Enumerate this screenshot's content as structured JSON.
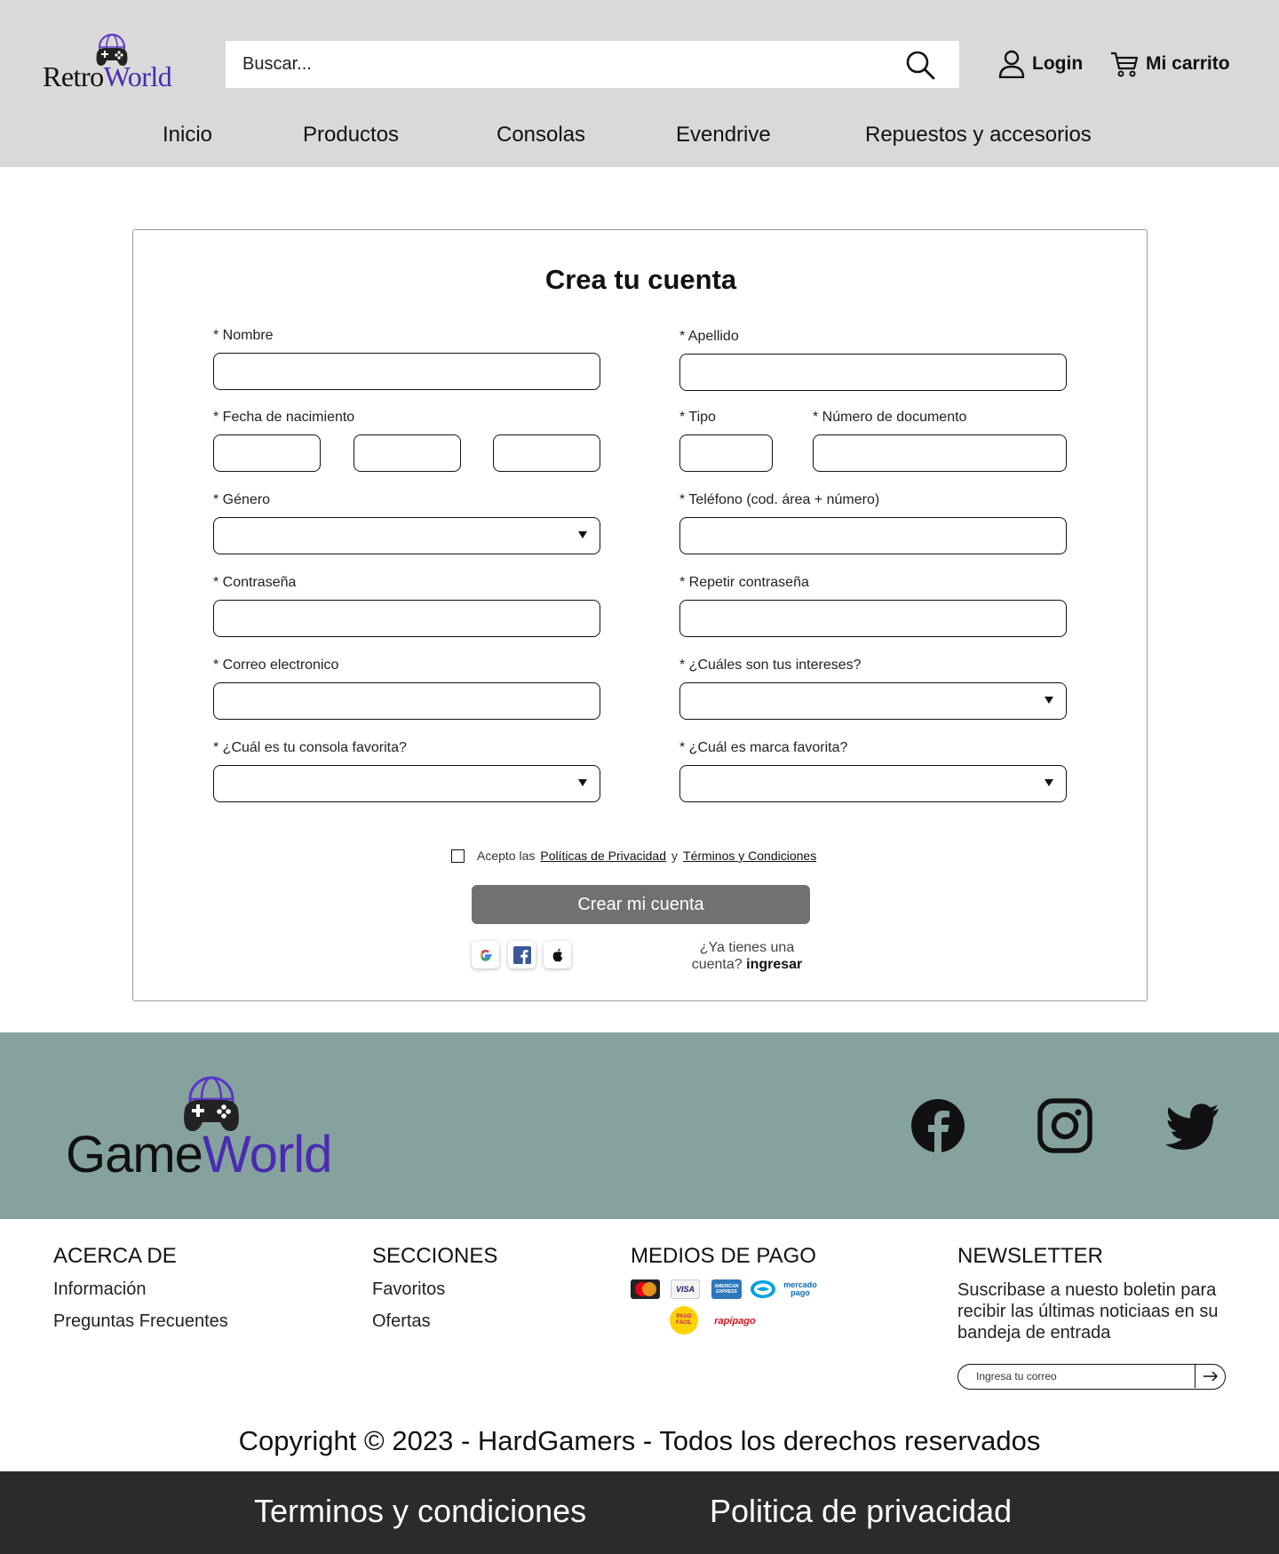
{
  "header": {
    "logo": {
      "part1": "Retro",
      "part2": "World"
    },
    "search_placeholder": "Buscar...",
    "login_label": "Login",
    "cart_label": "Mi carrito",
    "nav": [
      "Inicio",
      "Productos",
      "Consolas",
      "Evendrive",
      "Repuestos y accesorios"
    ]
  },
  "form": {
    "title": "Crea tu cuenta",
    "labels": {
      "nombre": "* Nombre",
      "apellido": "* Apellido",
      "fecha": "* Fecha de nacimiento",
      "tipo": "* Tipo",
      "documento": "* Número de documento",
      "genero": "* Género",
      "telefono": "* Teléfono (cod. área + número)",
      "contrasena": "* Contraseña",
      "repetir": "* Repetir contraseña",
      "correo": "* Correo electronico",
      "intereses": "* ¿Cuáles son tus intereses?",
      "consola": "* ¿Cuál es tu consola favorita?",
      "marca": "* ¿Cuál es marca favorita?"
    },
    "terms": {
      "prefix": "Acepto las",
      "privacy": "Políticas de Privacidad",
      "and": "y",
      "conditions": "Términos y Condiciones"
    },
    "submit_label": "Crear mi cuenta",
    "social_icons": [
      "google-icon",
      "facebook-icon",
      "apple-icon"
    ],
    "have_account": "¿Ya tienes una cuenta?",
    "login_link": "ingresar"
  },
  "footer_band": {
    "logo": {
      "part1": "Game",
      "part2": "World"
    },
    "social_icons": [
      "facebook-icon",
      "instagram-icon",
      "twitter-icon"
    ]
  },
  "footer": {
    "about": {
      "title": "ACERCA DE",
      "items": [
        "Información",
        "Preguntas Frecuentes"
      ]
    },
    "sections": {
      "title": "SECCIONES",
      "items": [
        "Favoritos",
        "Ofertas"
      ]
    },
    "payment": {
      "title": "MEDIOS DE PAGO",
      "methods": [
        "MasterCard",
        "VISA",
        "AMERICAN EXPRESS",
        "mercado pago",
        "PAGO FÁCIL",
        "rapipago"
      ]
    },
    "newsletter": {
      "title": "NEWSLETTER",
      "text": "Suscribase a nuesto boletin para recibir las últimas noticiaas en su bandeja de entrada",
      "placeholder": "Ingresa tu correo"
    },
    "copyright": "Copyright © 2023 - HardGamers - Todos los derechos reservados",
    "bottom_links": [
      "Terminos y condiciones",
      "Politica de privacidad"
    ]
  },
  "colors": {
    "header_bg": "#d9d9d9",
    "brand_purple": "#4a2bb0",
    "band_bg": "#85a29f",
    "button_bg": "#717171",
    "bottom_bg": "#2b2b2b"
  }
}
